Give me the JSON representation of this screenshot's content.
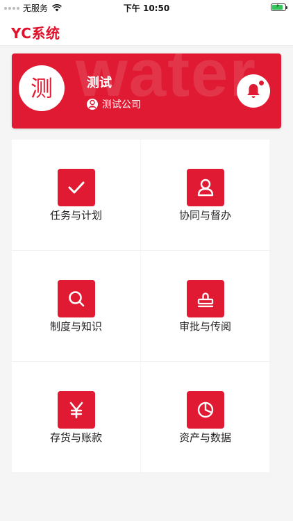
{
  "status_bar": {
    "carrier": "无服务",
    "time": "下午 10:50",
    "battery_level": 0.85
  },
  "header": {
    "title": "YC系统"
  },
  "profile": {
    "avatar_char": "测",
    "name": "测试",
    "company": "测试公司",
    "watermark": "water"
  },
  "menu": {
    "items": [
      {
        "label": "任务与计划",
        "icon": "check-icon"
      },
      {
        "label": "协同与督办",
        "icon": "user-icon"
      },
      {
        "label": "制度与知识",
        "icon": "search-icon"
      },
      {
        "label": "审批与传阅",
        "icon": "stamp-icon"
      },
      {
        "label": "存货与账款",
        "icon": "yen-icon"
      },
      {
        "label": "资产与数据",
        "icon": "pie-chart-icon"
      }
    ]
  },
  "colors": {
    "accent": "#e01a32",
    "background": "#f5f5f5",
    "battery": "#34c759"
  }
}
